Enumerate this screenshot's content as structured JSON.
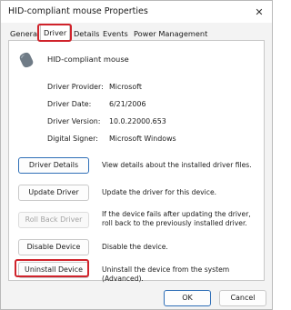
{
  "window": {
    "title": "HID-compliant mouse Properties",
    "close_glyph": "✕"
  },
  "tabs": [
    {
      "label": "General"
    },
    {
      "label": "Driver",
      "active": true
    },
    {
      "label": "Details"
    },
    {
      "label": "Events"
    },
    {
      "label": "Power Management"
    }
  ],
  "device": {
    "name": "HID-compliant mouse",
    "icon": "mouse-icon"
  },
  "properties": [
    {
      "label": "Driver Provider:",
      "value": "Microsoft"
    },
    {
      "label": "Driver Date:",
      "value": "6/21/2006"
    },
    {
      "label": "Driver Version:",
      "value": "10.0.22000.653"
    },
    {
      "label": "Digital Signer:",
      "value": "Microsoft Windows"
    }
  ],
  "actions": [
    {
      "button": "Driver Details",
      "description": "View details about the installed driver files.",
      "enabled": true
    },
    {
      "button": "Update Driver",
      "description": "Update the driver for this device.",
      "enabled": true
    },
    {
      "button": "Roll Back Driver",
      "description": "If the device fails after updating the driver, roll back to the previously installed driver.",
      "enabled": false
    },
    {
      "button": "Disable Device",
      "description": "Disable the device.",
      "enabled": true
    },
    {
      "button": "Uninstall Device",
      "description": "Uninstall the device from the system (Advanced).",
      "enabled": true
    }
  ],
  "footer": {
    "ok_label": "OK",
    "cancel_label": "Cancel"
  },
  "colors": {
    "highlight": "#d0232b",
    "accent": "#2f6fb7"
  }
}
